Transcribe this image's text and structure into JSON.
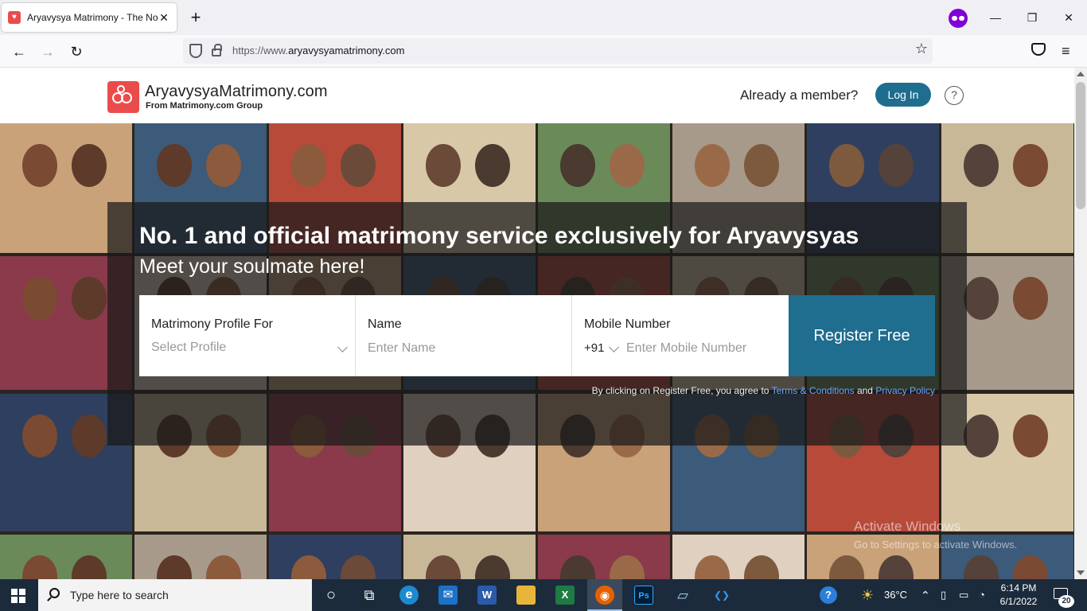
{
  "browser": {
    "tab_title": "Aryavysya Matrimony - The No",
    "tab_close": "✕",
    "new_tab": "+",
    "url_prefix": "https://www.",
    "url_domain": "aryavysyamatrimony.com",
    "controls": {
      "minimize": "—",
      "restore": "❐",
      "close": "✕"
    },
    "nav": {
      "back": "←",
      "forward": "→",
      "reload": "↻"
    },
    "bookmark_star": "☆",
    "menu": "≡"
  },
  "header": {
    "brand_name": "AryavysyaMatrimony.com",
    "brand_sub": "From Matrimony.com Group",
    "already_member": "Already a member?",
    "login_label": "Log In",
    "help_glyph": "?"
  },
  "hero": {
    "title": "No. 1 and official matrimony service exclusively for Aryavysyas",
    "subtitle": "Meet your soulmate here!",
    "form": {
      "profile_for_label": "Matrimony Profile For",
      "profile_for_placeholder": "Select Profile",
      "name_label": "Name",
      "name_placeholder": "Enter Name",
      "mobile_label": "Mobile Number",
      "country_code": "+91",
      "mobile_placeholder": "Enter Mobile Number",
      "register_label": "Register Free"
    },
    "terms_prefix": "By clicking on Register Free, you agree to ",
    "terms_link": "Terms & Conditions",
    "terms_and": " and ",
    "privacy_link": "Privacy Policy"
  },
  "watermark": {
    "line1": "Activate Windows",
    "line2": "Go to Settings to activate Windows."
  },
  "taskbar": {
    "search_placeholder": "Type here to search",
    "weather": "36°C",
    "time": "6:14 PM",
    "date": "6/1/2022",
    "notification_count": "20",
    "apps": [
      {
        "name": "cortana",
        "glyph": "○"
      },
      {
        "name": "task-view",
        "glyph": "⧉"
      },
      {
        "name": "edge",
        "glyph": "e"
      },
      {
        "name": "mail",
        "glyph": "✉"
      },
      {
        "name": "word",
        "glyph": "W"
      },
      {
        "name": "file-explorer",
        "glyph": "▬"
      },
      {
        "name": "excel",
        "glyph": "X"
      },
      {
        "name": "firefox",
        "glyph": "◉"
      },
      {
        "name": "photoshop",
        "glyph": "Ps"
      },
      {
        "name": "notepad",
        "glyph": "▱"
      },
      {
        "name": "vscode",
        "glyph": "❮❯"
      }
    ]
  },
  "colors": {
    "brand_red": "#ea4c4c",
    "brand_teal": "#1f6d8f",
    "link_blue": "#6aa8ff",
    "taskbar": "#1c2b3c"
  }
}
